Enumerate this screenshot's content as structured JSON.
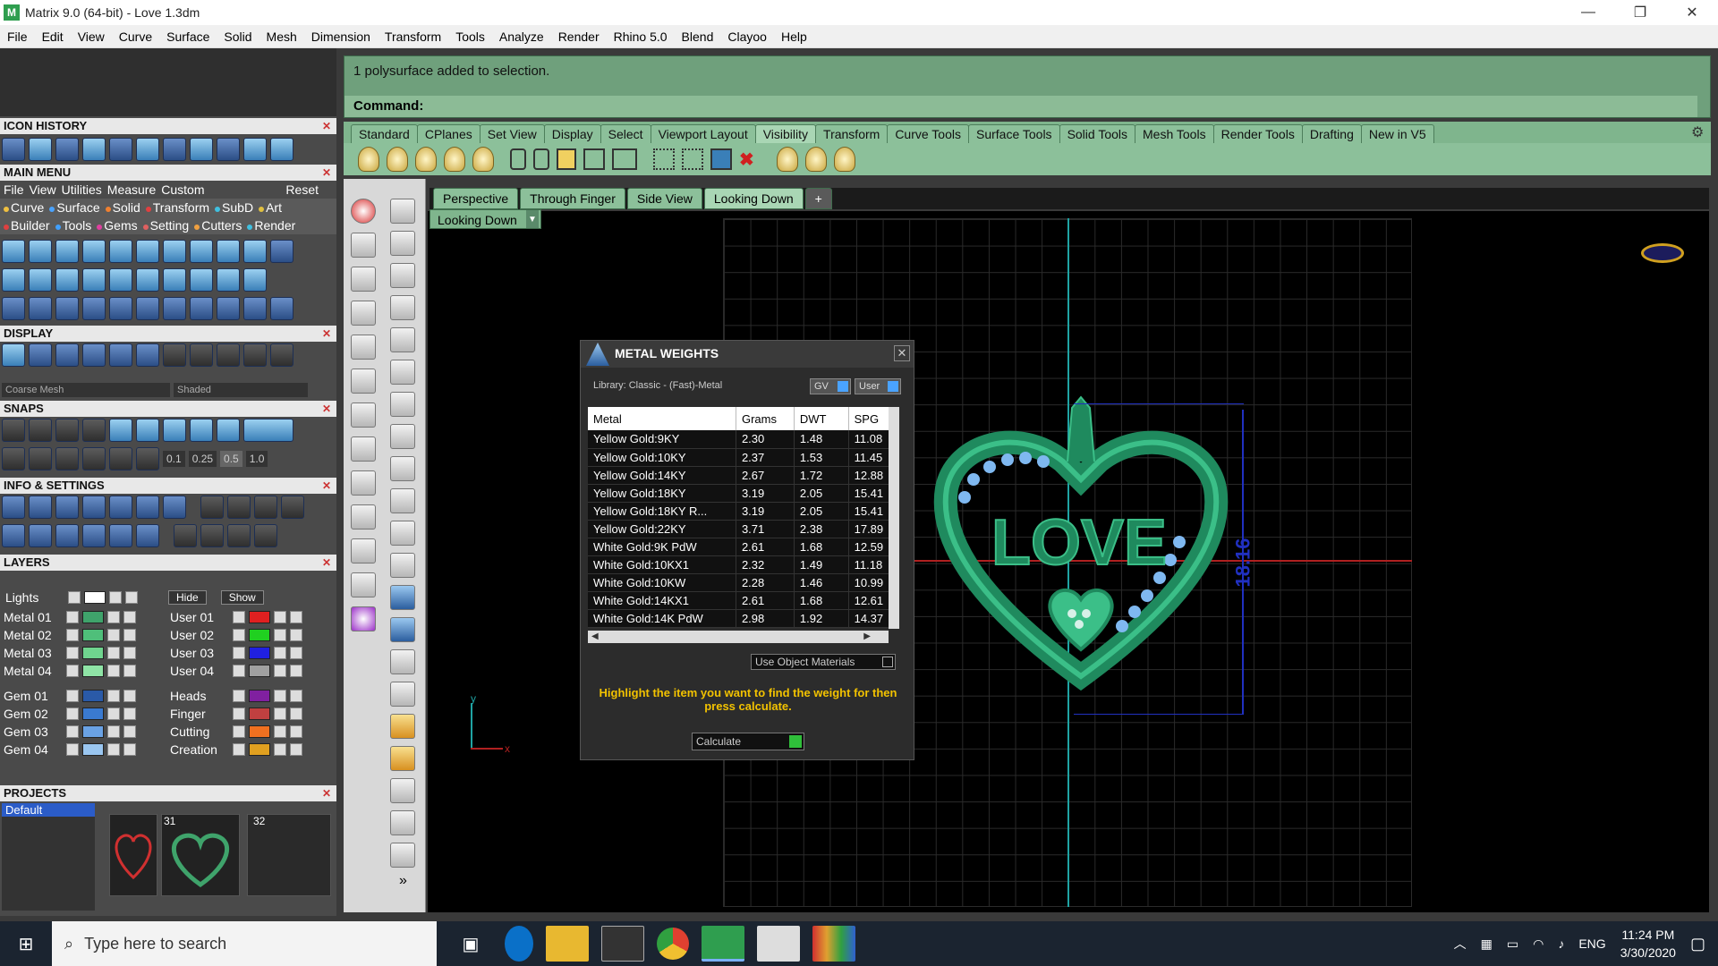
{
  "window": {
    "title": "Matrix 9.0 (64-bit) - Love 1.3dm",
    "min": "—",
    "max": "❐",
    "close": "✕"
  },
  "menubar": [
    "File",
    "Edit",
    "View",
    "Curve",
    "Surface",
    "Solid",
    "Mesh",
    "Dimension",
    "Transform",
    "Tools",
    "Analyze",
    "Render",
    "Rhino 5.0",
    "Blend",
    "Clayoo",
    "Help"
  ],
  "left": {
    "icon_history": "ICON HISTORY",
    "main_menu": "MAIN MENU",
    "main_menu_items": [
      "File",
      "View",
      "Utilities",
      "Measure",
      "Custom",
      "Reset"
    ],
    "main_menu_row2": [
      {
        "label": "Curve",
        "color": "#f0c040"
      },
      {
        "label": "Surface",
        "color": "#4aa3ff"
      },
      {
        "label": "Solid",
        "color": "#f08030"
      },
      {
        "label": "Transform",
        "color": "#e04040"
      },
      {
        "label": "SubD",
        "color": "#40c0e0"
      },
      {
        "label": "Art",
        "color": "#e0c040"
      }
    ],
    "main_menu_row3": [
      {
        "label": "Builder",
        "color": "#e04040"
      },
      {
        "label": "Tools",
        "color": "#40a0ff"
      },
      {
        "label": "Gems",
        "color": "#e040a0"
      },
      {
        "label": "Setting",
        "color": "#e06060"
      },
      {
        "label": "Cutters",
        "color": "#f0a040"
      },
      {
        "label": "Render",
        "color": "#40c0e0"
      }
    ],
    "display": "DISPLAY",
    "display_mesh": "Coarse Mesh",
    "display_mode": "Shaded",
    "snaps": "SNAPS",
    "snap_values": [
      "0.1",
      "0.25",
      "0.5",
      "1.0"
    ],
    "info_settings": "INFO & SETTINGS",
    "layers": "LAYERS",
    "lights_label": "Lights",
    "hide_label": "Hide",
    "show_label": "Show",
    "layers_left": [
      {
        "name": "Metal 01",
        "color": "#3fa36b"
      },
      {
        "name": "Metal 02",
        "color": "#4fbf7a"
      },
      {
        "name": "Metal 03",
        "color": "#6fd48e"
      },
      {
        "name": "Metal 04",
        "color": "#8fe4a6"
      },
      {
        "name": "Gem 01",
        "color": "#2a5aa8"
      },
      {
        "name": "Gem 02",
        "color": "#3a7ad0"
      },
      {
        "name": "Gem 03",
        "color": "#6aa2e4"
      },
      {
        "name": "Gem 04",
        "color": "#9ac6f0"
      }
    ],
    "layers_right": [
      {
        "name": "User 01",
        "color": "#e02020"
      },
      {
        "name": "User 02",
        "color": "#20d020"
      },
      {
        "name": "User 03",
        "color": "#2020e0"
      },
      {
        "name": "User 04",
        "color": "#a0a0a0"
      },
      {
        "name": "Heads",
        "color": "#8020a0"
      },
      {
        "name": "Finger",
        "color": "#c04040"
      },
      {
        "name": "Cutting",
        "color": "#f07020"
      },
      {
        "name": "Creation",
        "color": "#e0a020"
      }
    ],
    "projects": "PROJECTS",
    "project_default": "Default",
    "project_nums": [
      "31",
      "32"
    ]
  },
  "command": {
    "line1": "1 polysurface added to selection.",
    "prompt": "Command:"
  },
  "toolbar_tabs": [
    "Standard",
    "CPlanes",
    "Set View",
    "Display",
    "Select",
    "Viewport Layout",
    "Visibility",
    "Transform",
    "Curve Tools",
    "Surface Tools",
    "Solid Tools",
    "Mesh Tools",
    "Render Tools",
    "Drafting",
    "New in V5"
  ],
  "toolbar_active": "Visibility",
  "viewport_tabs": [
    "Perspective",
    "Through Finger",
    "Side View",
    "Looking Down"
  ],
  "viewport_active": "Looking Down",
  "viewport_add": "+",
  "viewport_name": "Looking Down",
  "dimension_label": "18.16",
  "axis_y": "y",
  "axis_x": "x",
  "model_text": "LOVE",
  "dialog": {
    "title": "METAL WEIGHTS",
    "close": "✕",
    "library": "Library: Classic - (Fast)-Metal",
    "gv": "GV",
    "user": "User",
    "headers": [
      "Metal",
      "Grams",
      "DWT",
      "SPG"
    ],
    "rows": [
      [
        "Yellow Gold:9KY",
        "2.30",
        "1.48",
        "11.08"
      ],
      [
        "Yellow Gold:10KY",
        "2.37",
        "1.53",
        "11.45"
      ],
      [
        "Yellow Gold:14KY",
        "2.67",
        "1.72",
        "12.88"
      ],
      [
        "Yellow Gold:18KY",
        "3.19",
        "2.05",
        "15.41"
      ],
      [
        "Yellow Gold:18KY R...",
        "3.19",
        "2.05",
        "15.41"
      ],
      [
        "Yellow Gold:22KY",
        "3.71",
        "2.38",
        "17.89"
      ],
      [
        "White Gold:9K PdW",
        "2.61",
        "1.68",
        "12.59"
      ],
      [
        "White Gold:10KX1",
        "2.32",
        "1.49",
        "11.18"
      ],
      [
        "White Gold:10KW",
        "2.28",
        "1.46",
        "10.99"
      ],
      [
        "White Gold:14KX1",
        "2.61",
        "1.68",
        "12.61"
      ],
      [
        "White Gold:14K PdW",
        "2.98",
        "1.92",
        "14.37"
      ]
    ],
    "use_object_materials": "Use Object Materials",
    "instruction": "Highlight the item you want to find the weight for then press calculate.",
    "calculate": "Calculate"
  },
  "taskbar": {
    "search_placeholder": "Type here to search",
    "lang": "ENG",
    "time": "11:24 PM",
    "date": "3/30/2020"
  },
  "colors": {
    "accent_green": "#7fb58d",
    "heart": "#1f8a5e",
    "gem": "#7fb8f0"
  }
}
